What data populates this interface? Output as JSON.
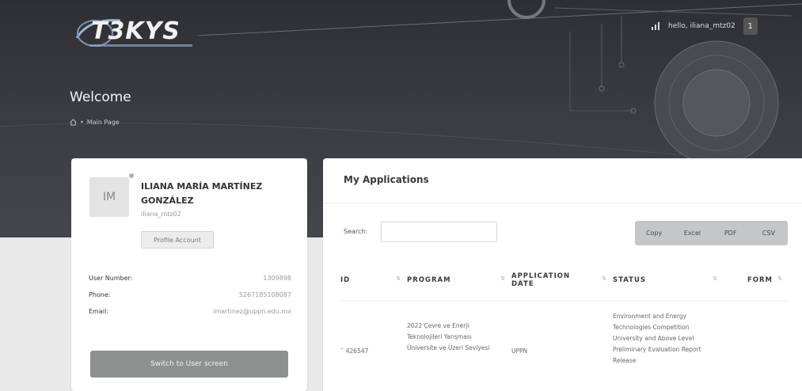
{
  "header": {
    "logo_text": "T3KYS",
    "user_greeting": "hello, iliana_mtz02",
    "user_menu_label": "1",
    "welcome_title": "Welcome",
    "breadcrumb_page": "Main Page"
  },
  "profile": {
    "avatar_initials": "IM",
    "full_name": "ILIANA MARÍA MARTÍNEZ GONZÁLEZ",
    "username": "iliana_mtz02",
    "profile_button_label": "Profile Account",
    "fields": [
      {
        "label": "User Number:",
        "value": "1309898"
      },
      {
        "label": "Phone:",
        "value": "5267185108087"
      },
      {
        "label": "Email:",
        "value": "imartinez@uppn.edu.mx"
      }
    ],
    "switch_button_label": "Switch to User screen"
  },
  "applications": {
    "title": "My Applications",
    "search_label": "Search:",
    "search_value": "",
    "export_buttons": [
      "Copy",
      "Excel",
      "PDF",
      "CSV"
    ],
    "columns": [
      "ID",
      "PROGRAM",
      "APPLICATION DATE",
      "STATUS",
      "FORM"
    ],
    "rows": [
      {
        "id": "426547",
        "program": "2022 Çevre ve Enerji Teknolojileri Yarışması Üniversite ve Üzeri Seviyesi",
        "application_date": "UPPN",
        "status": "Environment and Energy Technologies Competition University and Above Level Preliminary Evaluation Report Release",
        "form": ""
      }
    ]
  }
}
